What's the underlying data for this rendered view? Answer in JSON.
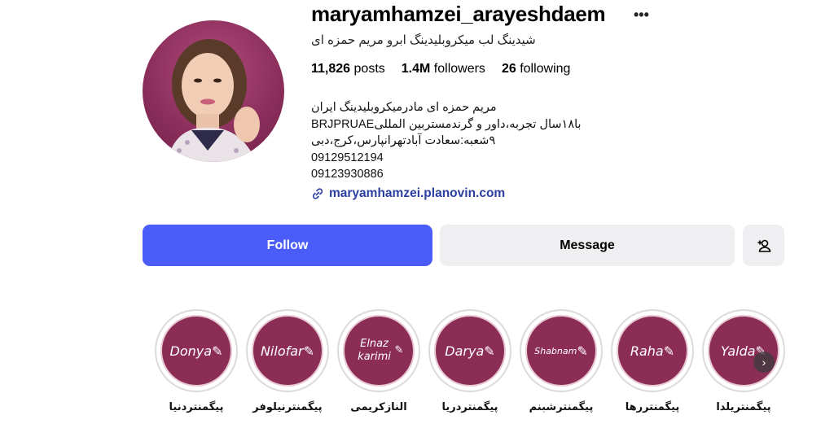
{
  "profile": {
    "username": "maryamhamzei_arayeshdaem",
    "subtitle": "شیدینگ لب میکروبلیدینگ ابرو مریم حمزه ای",
    "stats": {
      "posts_count": "11,826",
      "posts_label": "posts",
      "followers_count": "1.4M",
      "followers_label": "followers",
      "following_count": "26",
      "following_label": "following"
    },
    "bio": {
      "line1": "مریم حمزه ای مادرمیکروبلیدینگ ایران",
      "line2": "با۱۸سال تجربه،داور و گرندمستربین المللیBRJPRUAE",
      "line3": "۹شعبه:سعادت آبادتهرانپارس،کرج،دبی",
      "line4": "09129512194",
      "line5": "09123930886"
    },
    "link": "maryamhamzei.planovin.com"
  },
  "actions": {
    "follow_label": "Follow",
    "message_label": "Message"
  },
  "highlights": [
    {
      "cover": "Donya",
      "label": "پیگمنتردنیا"
    },
    {
      "cover": "Nilofar",
      "label": "پیگمنترنیلوفر"
    },
    {
      "cover": "Elnaz karimi",
      "label": "النازکریمی"
    },
    {
      "cover": "Darya",
      "label": "پیگمنتردریا"
    },
    {
      "cover": "Shabnam",
      "label": "پیگمنترشبنم"
    },
    {
      "cover": "Raha",
      "label": "پیگمنتررها"
    },
    {
      "cover": "Yalda",
      "label": "پیگمنتریلدا"
    }
  ],
  "colors": {
    "follow_bg": "#4a5df9",
    "highlight_bg": "#8b2d55",
    "link": "#2b3fa0"
  }
}
